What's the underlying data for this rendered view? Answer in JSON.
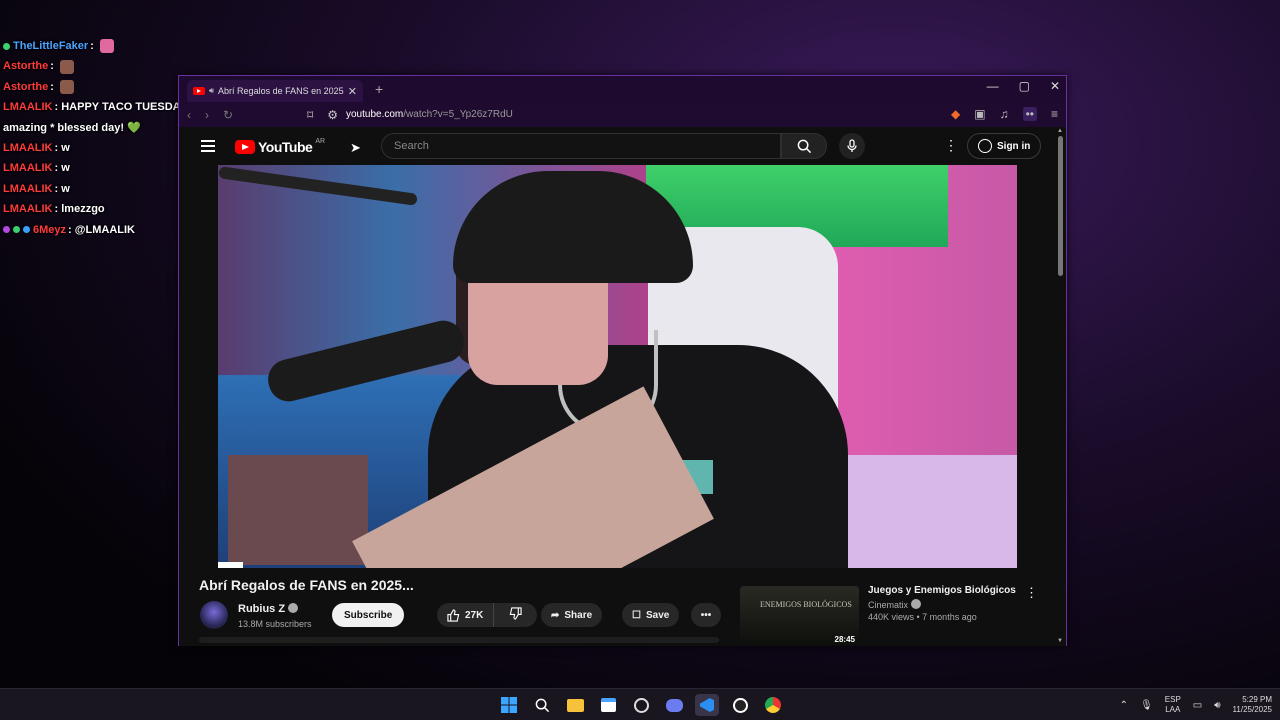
{
  "chat": [
    {
      "user": "TheLittleFaker",
      "color": "#4aa3ff",
      "text": "",
      "badges": [
        "#3bd16f"
      ],
      "emote": "#e06aa0"
    },
    {
      "user": "Astorthe",
      "color": "#ff3b3b",
      "text": "",
      "badges": [],
      "emote": "#8a5a4a"
    },
    {
      "user": "Astorthe",
      "color": "#ff3b3b",
      "text": "",
      "badges": [],
      "emote": "#8a5a4a"
    },
    {
      "user": "LMAALIK",
      "color": "#ff3b3b",
      "text": "HAPPY TACO TUESDAYYY! Lets have a amazing * blessed day! 💚",
      "badges": [],
      "emote": ""
    },
    {
      "user": "LMAALIK",
      "color": "#ff3b3b",
      "text": "w",
      "badges": [],
      "emote": ""
    },
    {
      "user": "LMAALIK",
      "color": "#ff3b3b",
      "text": "w",
      "badges": [],
      "emote": ""
    },
    {
      "user": "LMAALIK",
      "color": "#ff3b3b",
      "text": "w",
      "badges": [],
      "emote": ""
    },
    {
      "user": "LMAALIK",
      "color": "#ff3b3b",
      "text": "lmezzgo",
      "badges": [],
      "emote": ""
    },
    {
      "user": "6Meyz",
      "color": "#ff3b3b",
      "text": "@LMAALIK",
      "badges": [
        "#b04ae0",
        "#3bd16f",
        "#3aa0ff"
      ],
      "emote": ""
    }
  ],
  "browser": {
    "tab_title": "Abrí Regalos de FANS en 2025",
    "url_host": "youtube.com",
    "url_path": "/watch?v=5_Yp26z7RdU",
    "new_tab": "+",
    "minimize": "—",
    "maximize": "▢",
    "close": "✕"
  },
  "youtube": {
    "logo_text": "YouTube",
    "country": "AR",
    "search_placeholder": "Search",
    "sign_in": "Sign in",
    "video_title": "Abrí Regalos de FANS en 2025...",
    "channel_name": "Rubius Z",
    "subscribers": "13.8M subscribers",
    "subscribe_label": "Subscribe",
    "likes": "27K",
    "share_label": "Share",
    "save_label": "Save",
    "more_label": "•••",
    "rec": {
      "title": "Juegos y Enemigos Biológicos",
      "channel": "Cinematix",
      "meta": "440K views • 7 months ago",
      "duration": "28:45",
      "thumb_text": "ENEMIGOS BIOLÓGICOS"
    }
  },
  "taskbar": {
    "lang_line1": "ESP",
    "lang_line2": "LAA",
    "time": "5:29 PM",
    "date": "11/25/2025"
  }
}
